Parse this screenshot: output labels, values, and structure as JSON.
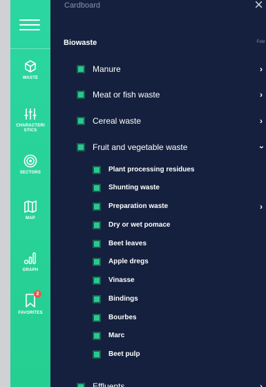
{
  "sidebar": {
    "items": [
      {
        "label": "WASTE",
        "icon": "cube-icon"
      },
      {
        "label": "CHARACTERI STICS",
        "icon": "sliders-icon"
      },
      {
        "label": "SECTORS",
        "icon": "target-icon"
      },
      {
        "label": "MAP",
        "icon": "map-icon"
      },
      {
        "label": "GRAPH",
        "icon": "graph-icon"
      },
      {
        "label": "FAVORITES",
        "icon": "bookmark-icon",
        "badge": "2"
      }
    ]
  },
  "panel": {
    "cut_heading": "Cardboard",
    "section_title": "Biowaste",
    "fold_label": "Fold",
    "categories": [
      {
        "label": "Manure"
      },
      {
        "label": "Meat or fish waste"
      },
      {
        "label": "Cereal waste"
      },
      {
        "label": "Fruit and vegetable waste"
      }
    ],
    "subitems": [
      {
        "label": "Plant processing residues"
      },
      {
        "label": "Shunting waste"
      },
      {
        "label": "Preparation waste"
      },
      {
        "label": "Dry or wet pomace"
      },
      {
        "label": "Beet leaves"
      },
      {
        "label": "Apple dregs"
      },
      {
        "label": "Vinasse"
      },
      {
        "label": "Bindings"
      },
      {
        "label": "Bourbes"
      },
      {
        "label": "Marc"
      },
      {
        "label": "Beet pulp"
      }
    ],
    "next_category": "Effluents"
  },
  "colors": {
    "accent": "#2bd6a0",
    "panel_bg": "#14203d",
    "badge": "#e8574a"
  }
}
